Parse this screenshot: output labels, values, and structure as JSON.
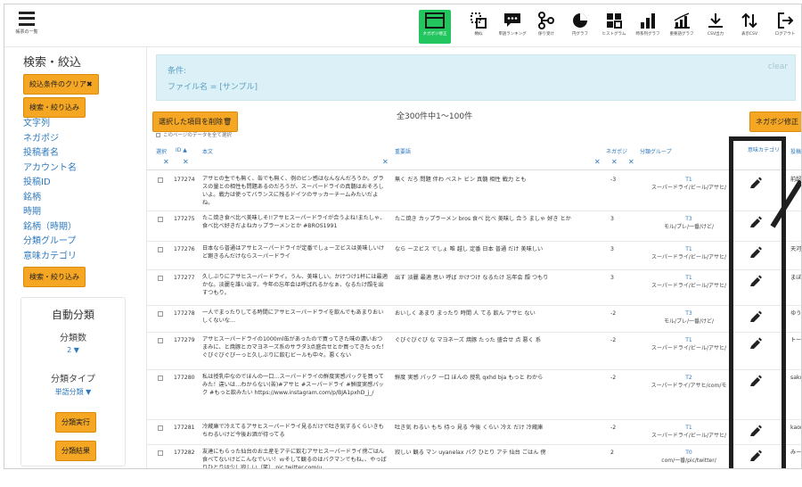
{
  "toolbar": {
    "menu_caption": "帳票の一覧",
    "tools": [
      {
        "caption": "ネガポジ修正",
        "icon": "table-icon",
        "active": true
      },
      {
        "caption": "類似",
        "icon": "similar-icon",
        "active": false
      },
      {
        "caption": "単語ランキング",
        "icon": "chat-icon",
        "active": false
      },
      {
        "caption": "係り受け",
        "icon": "dependency-icon",
        "active": false
      },
      {
        "caption": "円グラフ",
        "icon": "pie-icon",
        "active": false
      },
      {
        "caption": "ヒストグラム",
        "icon": "histogram-icon",
        "active": false
      },
      {
        "caption": "時系列グラフ",
        "icon": "bar-icon",
        "active": false
      },
      {
        "caption": "重要語グラフ",
        "icon": "line-icon",
        "active": false
      },
      {
        "caption": "CSV出力",
        "icon": "download-icon",
        "active": false
      },
      {
        "caption": "表示CSV",
        "icon": "sort-icon",
        "active": false
      },
      {
        "caption": "ログアウト",
        "icon": "logout-icon",
        "active": false
      }
    ]
  },
  "sidebar": {
    "title": "検索・絞込",
    "clear_button": "絞込条件のクリア✖",
    "filter_button_top": "検索・絞り込み",
    "links": [
      "文字列",
      "ネガポジ",
      "投稿者名",
      "アカウント名",
      "投稿ID",
      "銘柄",
      "時期",
      "銘柄（時期）",
      "分類グループ",
      "意味カテゴリ"
    ],
    "filter_button_bottom": "検索・絞り込み",
    "auto": {
      "title": "自動分類",
      "count_label": "分類数",
      "count_value": "2 ▼",
      "type_label": "分類タイプ",
      "type_value": "単語分類 ▼",
      "run_button": "分類実行",
      "result_button": "分類結果"
    }
  },
  "conditions": {
    "label": "条件:",
    "value": "ファイル名 = [サンプル]",
    "clear": "clear"
  },
  "actions": {
    "delete_button": "選択した項目を削除🗑",
    "count_text": "全300件中1～100件",
    "select_all": "このページのデータを全て選択",
    "negapos_button": "ネガポジ修正"
  },
  "table": {
    "headers": {
      "select": "選択",
      "id": "ID ▲",
      "body": "本文",
      "keywords": "重要語",
      "negapos": "ネガポジ",
      "group": "分類グループ",
      "category": "意味カテゴリ",
      "poster": "投稿"
    },
    "rows": [
      {
        "id": "177274",
        "body": "アサヒの生でも無く、缶でも無く、例のビン感はなんなんだろうか。グラスの量との相性も問題あるのだろうが、スーパードライの真髄はおそろしいよ。戦力は使ってバランスに残るドイツのサッカーチームみたいだよね。",
        "keywords": "無く だろ 問題 伴わ ベスト ビン 真髄 相性 戦力 とも",
        "negapos": "-3",
        "group_t": "T1",
        "group_n": "スーパードライ/ビール/アサヒ/",
        "poster": "前超"
      },
      {
        "id": "177275",
        "body": "たこ焼き食べ比べ美味しそ!!アサヒスーパードライが合うよね!またしゃ、食べ比べ好きだよねカップラーメンとか #BROS1991",
        "keywords": "たこ焼き カップラーメン bros 食べ 比べ 美味し 合う ましゃ 好き とか",
        "negapos": "3",
        "group_t": "T3",
        "group_n": "モル/プレ/一番/けど/",
        "poster": ""
      },
      {
        "id": "177276",
        "body": "日本なら普通はアサヒスーパードライが定番でしょーヱビスは美味しいけど飽きるんだけならスーパードライ",
        "keywords": "なら ーヱビス でしょ 唯 越し 定番 日本 普通 だけ 美味しい",
        "negapos": "3",
        "group_t": "T1",
        "group_n": "スーパードライ/ビール/アサヒ/",
        "poster": "天河"
      },
      {
        "id": "177277",
        "body": "久しぶりにアサヒスーパードライ。うん、美味しい。かけつけ1杯には最適かな。淡麗を誰い出す。今年の忘年会は呼ばれるかなぁ、なるたけ顔を出すつもり。",
        "keywords": "出す 淡麗 最適 思い 呼ば かけつけ なるたけ 忘年会 顔 つもり",
        "negapos": "3",
        "group_t": "T1",
        "group_n": "スーパードライ/ビール/アサヒ/",
        "poster": "まぼ"
      },
      {
        "id": "177278",
        "body": "一人でまったりしてる時間にアサヒスーパードライを飲んでもあまりおいしくないな…",
        "keywords": "おいしく あまり まったり 時間 人 てる 飲ん アサヒ ない",
        "negapos": "-2",
        "group_t": "T3",
        "group_n": "モル/プレ/一番/けど/",
        "poster": "ゆう"
      },
      {
        "id": "177279",
        "body": "アサヒスーパードライの1000ml缶があったので買ってきた味の濃いおつまみに、と焼豚とカマヨネーズ系のサラダ3点盛合せとか買ってきたった！ぐびぐびぐびーっと久しぶりに飲むビールも中々。悪くない",
        "keywords": "ぐびぐびぐび な マヨネーズ 焼豚 たった 盛合せ 点 悪く 系",
        "negapos": "-2",
        "group_t": "T1",
        "group_n": "スーパードライ/ビール/アサヒ/",
        "poster": "トー"
      },
      {
        "id": "177280",
        "body": "私は授乳中なのでほんの一口…スーパードライの鮮度実感パックを買ってみた！違いは…わからない(苦)#アサヒ #スーパードライ #鮮度実感パック #もっと飲みたい https://www.instagram.com/p/BJA1pxhD_j_/",
        "keywords": "鮮度 実感 パック 一口 ほんの 授乳 qxhd bja もっと わから",
        "negapos": "-2",
        "group_t": "T2",
        "group_n": "スーパードライ/アサヒ/com/モ",
        "poster": "sakur"
      },
      {
        "id": "177281",
        "body": "冷蔵庫で冷えてるアサヒスーパードライ見るだけで吐き気するくらいきもちわるいけど今後お酒が待ってる",
        "keywords": "吐き気 わるい もち 待っ 見る 今後 くらい 冷え だけ 冷蔵庫",
        "negapos": "-2",
        "group_t": "T1",
        "group_n": "スーパードライ/ビール/アサヒ/",
        "poster": "kaoru"
      },
      {
        "id": "177282",
        "body": "友達にもらった仙台のお土産をアテに飲むアサヒスーパードライ傍ごはん食べてないけどこんなでいい！ｗそして観るのはバクマンでもね。、やっぱりひとりは少し寂しい（笑） pic.twitter.com/u",
        "keywords": "寂しい 観る マン uyanelax バク ひとり アテ 仙台 ごはん 傍",
        "negapos": "2",
        "group_t": "T0",
        "group_n": "com/一番/pic/twitter/",
        "poster": "みーか"
      }
    ]
  }
}
